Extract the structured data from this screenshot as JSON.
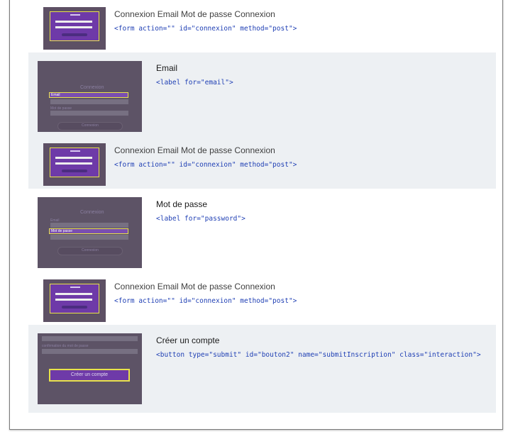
{
  "form_rows": [
    {
      "title": "Connexion Email Mot de passe Connexion",
      "code": "<form action=\"\" id=\"connexion\" method=\"post\">"
    },
    {
      "title": "Connexion Email Mot de passe Connexion",
      "code": "<form action=\"\" id=\"connexion\" method=\"post\">"
    },
    {
      "title": "Connexion Email Mot de passe Connexion",
      "code": "<form action=\"\" id=\"connexion\" method=\"post\">"
    }
  ],
  "element_rows": [
    {
      "title": "Email",
      "code": "<label for=\"email\">"
    },
    {
      "title": "Mot de passe",
      "code": "<label for=\"password\">"
    },
    {
      "title": "Créer un compte",
      "code": "<button type=\"submit\" id=\"bouton2\" name=\"submitInscription\" class=\"interaction\">"
    }
  ],
  "thumbnails": {
    "heading": "Connexion",
    "email_field": "Email",
    "password_field": "Mot de passe",
    "password_confirm_label": "confirmation du mot de passe",
    "button": "Connexion",
    "create_button": "Créer un compte"
  }
}
